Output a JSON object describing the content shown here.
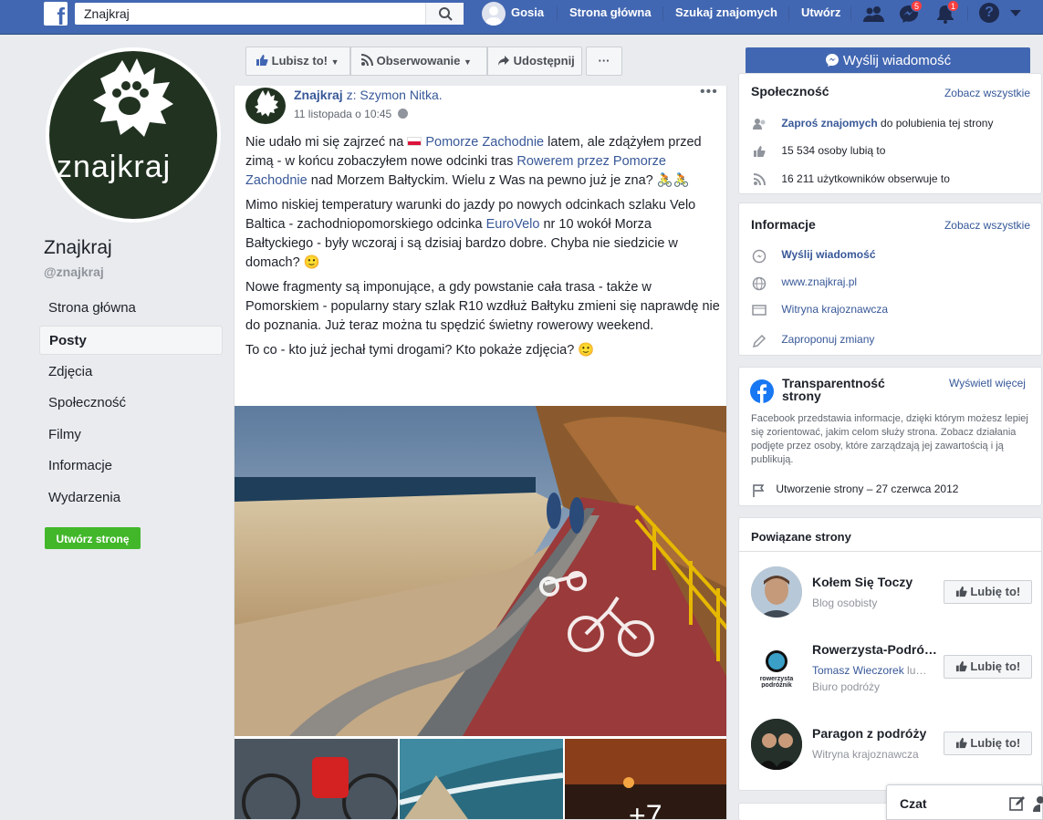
{
  "topbar": {
    "search_value": "Znajkraj",
    "user_name": "Gosia",
    "nav": [
      "Strona główna",
      "Szukaj znajomych",
      "Utwórz"
    ],
    "messages_badge": "5",
    "notifications_badge": "1",
    "help": "?"
  },
  "left": {
    "page_name": "Znajkraj",
    "page_handle": "@znajkraj",
    "logo_text": "znajkraj",
    "nav": [
      "Strona główna",
      "Posty",
      "Zdjęcia",
      "Społeczność",
      "Filmy",
      "Informacje",
      "Wydarzenia"
    ],
    "create_page": "Utwórz stronę"
  },
  "actions": {
    "like": "Lubisz to!",
    "follow": "Obserwowanie",
    "share": "Udostępnij",
    "more": "···",
    "send_message": "Wyślij wiadomość"
  },
  "post": {
    "author": "Znajkraj",
    "with": "z: Szymon Nitka.",
    "date": "11 listopada o 10:45",
    "more": "•••",
    "p1_a": "Nie udało mi się zajrzeć na",
    "p1_link1": "Pomorze Zachodnie",
    "p1_b": "latem, ale zdążyłem przed zimą - w końcu zobaczyłem nowe odcinki tras",
    "p1_link2": "Rowerem przez Pomorze Zachodnie",
    "p1_c": "nad Morzem Bałtyckim. Wielu z Was na pewno już je zna? 🚴🚴",
    "p2_a": "Mimo niskiej temperatury warunki do jazdy po nowych odcinkach szlaku Velo Baltica - zachodniopomorskiego odcinka",
    "p2_link": "EuroVelo",
    "p2_b": "nr 10 wokół Morza Bałtyckiego - były wczoraj i są dzisiaj bardzo dobre. Chyba nie siedzicie w domach? 🙂",
    "p3": "Nowe fragmenty są imponujące, a gdy powstanie cała trasa - także w Pomorskiem - popularny stary szlak R10 wzdłuż Bałtyku zmieni się naprawdę nie do poznania. Już teraz można tu spędzić świetny rowerowy weekend.",
    "p4": "To co - kto już jechał tymi drogami? Kto pokaże zdjęcia? 🙂",
    "more_photos": "+7"
  },
  "community": {
    "title": "Społeczność",
    "see_all": "Zobacz wszystkie",
    "invite_link": "Zaproś znajomych",
    "invite_rest": "do polubienia tej strony",
    "likes": "15 534 osoby lubią to",
    "follows": "16 211 użytkowników obserwuje to"
  },
  "info": {
    "title": "Informacje",
    "see_all": "Zobacz wszystkie",
    "send": "Wyślij wiadomość",
    "website": "www.znajkraj.pl",
    "category": "Witryna krajoznawcza",
    "suggest": "Zaproponuj zmiany"
  },
  "transparency": {
    "title": "Transparentność strony",
    "view": "Wyświetl więcej",
    "desc": "Facebook przedstawia informacje, dzięki którym możesz lepiej się zorientować, jakim celom służy strona. Zobacz działania podjęte przez osoby, które zarządzają jej zawartością i ją publikują.",
    "created": "Utworzenie strony – 27 czerwca 2012"
  },
  "related": {
    "title": "Powiązane strony",
    "like_label": "Lubię to!",
    "items": [
      {
        "name": "Kołem Się Toczy",
        "sub": "Blog osobisty",
        "sub2": ""
      },
      {
        "name": "Rowerzysta-Podró…",
        "sub": "Tomasz Wieczorek",
        "sub_rest": "lu…",
        "sub2": "Biuro podróży"
      },
      {
        "name": "Paragon z podróży",
        "sub": "Witryna krajoznawcza",
        "sub2": ""
      }
    ],
    "logo_text": "rowerzysta podróżnik"
  },
  "chat": {
    "label": "Czat"
  },
  "colors": {
    "brand": "#4267b2",
    "green": "#42b72a",
    "link": "#385898"
  }
}
